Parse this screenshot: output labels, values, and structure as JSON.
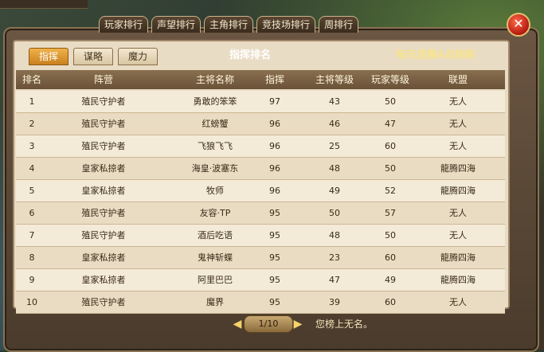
{
  "top_tabs": [
    "玩家排行",
    "声望排行",
    "主角排行",
    "竞技场排行",
    "周排行"
  ],
  "sub_tabs": [
    "指挥",
    "谋略",
    "魔力"
  ],
  "board_title": "指挥排名",
  "refresh_note": "每天凌晨4点刷新",
  "columns": [
    "排名",
    "阵营",
    "主将名称",
    "指挥",
    "主将等级",
    "玩家等级",
    "联盟"
  ],
  "rows": [
    {
      "rank": "1",
      "faction": "殖民守护者",
      "name": "勇敢的笨笨",
      "cmd": "97",
      "hero_lv": "43",
      "player_lv": "50",
      "alliance": "无人"
    },
    {
      "rank": "2",
      "faction": "殖民守护者",
      "name": "红螃蟹",
      "cmd": "96",
      "hero_lv": "46",
      "player_lv": "47",
      "alliance": "无人"
    },
    {
      "rank": "3",
      "faction": "殖民守护者",
      "name": "飞狼飞飞",
      "cmd": "96",
      "hero_lv": "25",
      "player_lv": "60",
      "alliance": "无人"
    },
    {
      "rank": "4",
      "faction": "皇家私掠者",
      "name": "海皇·波塞东",
      "cmd": "96",
      "hero_lv": "48",
      "player_lv": "50",
      "alliance": "龍腾四海"
    },
    {
      "rank": "5",
      "faction": "皇家私掠者",
      "name": "牧师",
      "cmd": "96",
      "hero_lv": "49",
      "player_lv": "52",
      "alliance": "龍腾四海"
    },
    {
      "rank": "6",
      "faction": "殖民守护者",
      "name": "友容·TP",
      "cmd": "95",
      "hero_lv": "50",
      "player_lv": "57",
      "alliance": "无人"
    },
    {
      "rank": "7",
      "faction": "殖民守护者",
      "name": "酒后吃语",
      "cmd": "95",
      "hero_lv": "48",
      "player_lv": "50",
      "alliance": "无人"
    },
    {
      "rank": "8",
      "faction": "皇家私掠者",
      "name": "鬼神斩蝶",
      "cmd": "95",
      "hero_lv": "23",
      "player_lv": "60",
      "alliance": "龍腾四海"
    },
    {
      "rank": "9",
      "faction": "皇家私掠者",
      "name": "阿里巴巴",
      "cmd": "95",
      "hero_lv": "47",
      "player_lv": "49",
      "alliance": "龍腾四海"
    },
    {
      "rank": "10",
      "faction": "殖民守护者",
      "name": "魔界",
      "cmd": "95",
      "hero_lv": "39",
      "player_lv": "60",
      "alliance": "无人"
    }
  ],
  "pager": {
    "text": "1/10",
    "prev": "◀",
    "next": "▶"
  },
  "status_text": "您榜上无名。",
  "close_glyph": "✕"
}
